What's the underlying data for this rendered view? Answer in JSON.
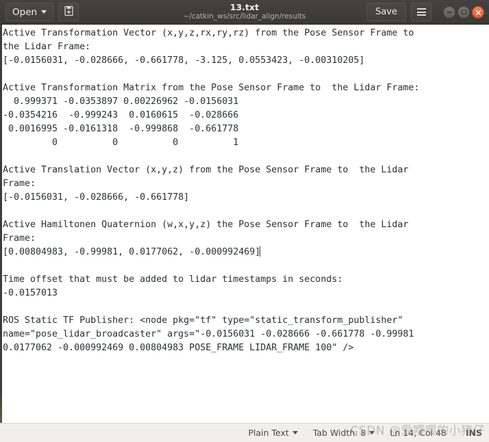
{
  "titlebar": {
    "open_label": "Open",
    "new_document_icon": "new-document-icon",
    "file_name": "13.txt",
    "file_path": "~/catkin_ws/src/lidar_align/results",
    "save_label": "Save",
    "menu_icon": "hamburger-menu-icon",
    "minimize_icon": "minimize-icon",
    "maximize_icon": "maximize-icon",
    "close_icon": "close-icon"
  },
  "editor": {
    "lines": [
      "Active Transformation Vector (x,y,z,rx,ry,rz) from the Pose Sensor Frame to",
      "the Lidar Frame:",
      "[-0.0156031, -0.028666, -0.661778, -3.125, 0.0553423, -0.00310205]",
      "",
      "Active Transformation Matrix from the Pose Sensor Frame to  the Lidar Frame:",
      "  0.999371 -0.0353897 0.00226962 -0.0156031",
      "-0.0354216  -0.999243  0.0160615  -0.028666",
      " 0.0016995 -0.0161318  -0.999868  -0.661778",
      "         0          0          0          1",
      "",
      "Active Translation Vector (x,y,z) from the Pose Sensor Frame to  the Lidar",
      "Frame:",
      "[-0.0156031, -0.028666, -0.661778]",
      "",
      "Active Hamiltonen Quaternion (w,x,y,z) the Pose Sensor Frame to  the Lidar",
      "Frame:",
      "[0.00804983, -0.99981, 0.0177062, -0.000992469]",
      "",
      "Time offset that must be added to lidar timestamps in seconds:",
      "-0.0157013",
      "",
      "ROS Static TF Publisher: <node pkg=\"tf\" type=\"static_transform_publisher\"",
      "name=\"pose_lidar_broadcaster\" args=\"-0.0156031 -0.028666 -0.661778 -0.99981",
      "0.0177062 -0.000992469 0.00804983 POSE_FRAME LIDAR_FRAME 100\" />"
    ],
    "caret_line_index": 16
  },
  "statusbar": {
    "language": "Plain Text",
    "tab_width": "Tab Width: 8",
    "cursor_position": "Ln 14, Col 48",
    "insert_mode": "INS"
  },
  "watermark": {
    "text": "CSDN @爱嘤嘤的小猪仔"
  },
  "colors": {
    "titlebar_bg": "#403e3c",
    "editor_bg": "#ffffff",
    "editor_text": "#2b2f33",
    "statusbar_bg": "#f0efed",
    "close_button": "#df5b33"
  }
}
